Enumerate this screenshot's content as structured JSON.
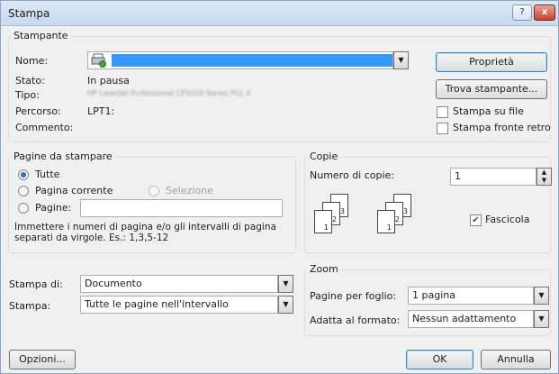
{
  "window": {
    "title": "Stampa"
  },
  "titlebar": {
    "help_label": "?",
    "close_label": "x"
  },
  "printer": {
    "group_label": "Stampante",
    "name_label": "Nome:",
    "status_label": "Stato:",
    "status_value": "In pausa",
    "type_label": "Tipo:",
    "type_value": "HP LaserJet Professional CP1020 Series PCL 6",
    "path_label": "Percorso:",
    "path_value": "LPT1:",
    "comment_label": "Commento:",
    "properties_button": "Proprietà",
    "find_printer_button": "Trova stampante...",
    "print_to_file_label": "Stampa su file",
    "duplex_label": "Stampa fronte retro"
  },
  "range": {
    "group_label": "Pagine da stampare",
    "all_label": "Tutte",
    "current_label": "Pagina corrente",
    "selection_label": "Selezione",
    "pages_label": "Pagine:",
    "pages_value": "",
    "hint_line1": "Immettere i numeri di pagina e/o gli intervalli di pagina",
    "hint_line2": "separati da virgole. Es.: 1,3,5-12"
  },
  "copies": {
    "group_label": "Copie",
    "number_label": "Numero di copie:",
    "number_value": "1",
    "collate_label": "Fascicola",
    "page_numbers": [
      "1",
      "2",
      "3"
    ]
  },
  "print_what": {
    "label": "Stampa di:",
    "value": "Documento"
  },
  "print_range": {
    "label": "Stampa:",
    "value": "Tutte le pagine nell'intervallo"
  },
  "zoom": {
    "group_label": "Zoom",
    "pages_per_sheet_label": "Pagine per foglio:",
    "pages_per_sheet_value": "1 pagina",
    "scale_label": "Adatta al formato:",
    "scale_value": "Nessun adattamento"
  },
  "footer": {
    "options_button": "Opzioni...",
    "ok_button": "OK",
    "cancel_button": "Annulla"
  }
}
